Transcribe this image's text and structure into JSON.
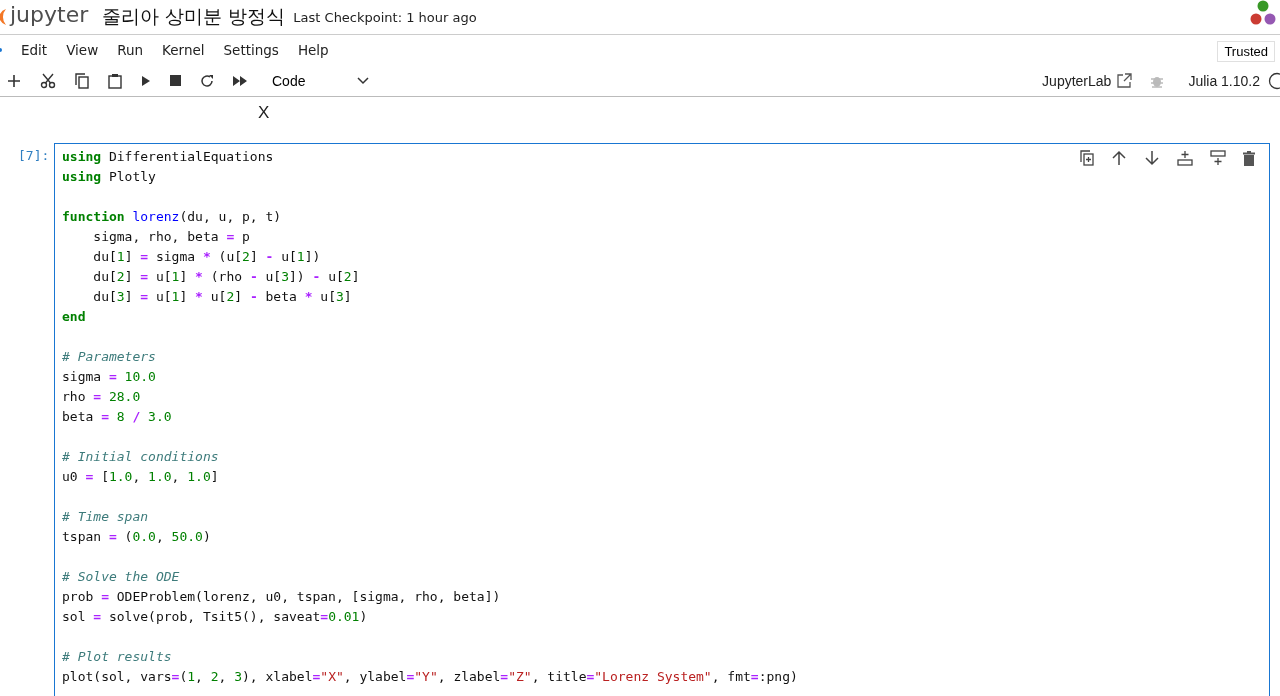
{
  "header": {
    "logo": "jupyter",
    "title": "줄리아 상미분 방정식",
    "checkpoint": "Last Checkpoint: 1 hour ago"
  },
  "menu": [
    "Edit",
    "View",
    "Run",
    "Kernel",
    "Settings",
    "Help"
  ],
  "trusted": "Trusted",
  "toolbar": {
    "cell_type": "Code",
    "jupyterlab": "JupyterLab",
    "kernel": "Julia 1.10.2"
  },
  "output_fragment": "X",
  "cell": {
    "prompt": "[7]:",
    "lines": [
      {
        "kind": "code",
        "tokens": [
          {
            "kind": "kw",
            "text": "using"
          },
          {
            "kind": "txt",
            "text": " DifferentialEquations"
          }
        ]
      },
      {
        "kind": "code",
        "tokens": [
          {
            "kind": "kw",
            "text": "using"
          },
          {
            "kind": "txt",
            "text": " Plotly"
          }
        ]
      },
      {
        "kind": "blank"
      },
      {
        "kind": "code",
        "tokens": [
          {
            "kind": "kw",
            "text": "function"
          },
          {
            "kind": "fn",
            "text": " lorenz"
          },
          {
            "kind": "txt",
            "text": "(du, u, p, t)"
          }
        ]
      },
      {
        "kind": "code",
        "tokens": [
          {
            "kind": "txt",
            "text": "    sigma, rho, beta "
          },
          {
            "kind": "op",
            "text": "="
          },
          {
            "kind": "txt",
            "text": " p"
          }
        ]
      },
      {
        "kind": "code",
        "tokens": [
          {
            "kind": "txt",
            "text": "    du["
          },
          {
            "kind": "num",
            "text": "1"
          },
          {
            "kind": "txt",
            "text": "] "
          },
          {
            "kind": "op",
            "text": "="
          },
          {
            "kind": "txt",
            "text": " sigma "
          },
          {
            "kind": "op",
            "text": "*"
          },
          {
            "kind": "txt",
            "text": " (u["
          },
          {
            "kind": "num",
            "text": "2"
          },
          {
            "kind": "txt",
            "text": "] "
          },
          {
            "kind": "op",
            "text": "-"
          },
          {
            "kind": "txt",
            "text": " u["
          },
          {
            "kind": "num",
            "text": "1"
          },
          {
            "kind": "txt",
            "text": "])"
          }
        ]
      },
      {
        "kind": "code",
        "tokens": [
          {
            "kind": "txt",
            "text": "    du["
          },
          {
            "kind": "num",
            "text": "2"
          },
          {
            "kind": "txt",
            "text": "] "
          },
          {
            "kind": "op",
            "text": "="
          },
          {
            "kind": "txt",
            "text": " u["
          },
          {
            "kind": "num",
            "text": "1"
          },
          {
            "kind": "txt",
            "text": "] "
          },
          {
            "kind": "op",
            "text": "*"
          },
          {
            "kind": "txt",
            "text": " (rho "
          },
          {
            "kind": "op",
            "text": "-"
          },
          {
            "kind": "txt",
            "text": " u["
          },
          {
            "kind": "num",
            "text": "3"
          },
          {
            "kind": "txt",
            "text": "]) "
          },
          {
            "kind": "op",
            "text": "-"
          },
          {
            "kind": "txt",
            "text": " u["
          },
          {
            "kind": "num",
            "text": "2"
          },
          {
            "kind": "txt",
            "text": "]"
          }
        ]
      },
      {
        "kind": "code",
        "tokens": [
          {
            "kind": "txt",
            "text": "    du["
          },
          {
            "kind": "num",
            "text": "3"
          },
          {
            "kind": "txt",
            "text": "] "
          },
          {
            "kind": "op",
            "text": "="
          },
          {
            "kind": "txt",
            "text": " u["
          },
          {
            "kind": "num",
            "text": "1"
          },
          {
            "kind": "txt",
            "text": "] "
          },
          {
            "kind": "op",
            "text": "*"
          },
          {
            "kind": "txt",
            "text": " u["
          },
          {
            "kind": "num",
            "text": "2"
          },
          {
            "kind": "txt",
            "text": "] "
          },
          {
            "kind": "op",
            "text": "-"
          },
          {
            "kind": "txt",
            "text": " beta "
          },
          {
            "kind": "op",
            "text": "*"
          },
          {
            "kind": "txt",
            "text": " u["
          },
          {
            "kind": "num",
            "text": "3"
          },
          {
            "kind": "txt",
            "text": "]"
          }
        ]
      },
      {
        "kind": "code",
        "tokens": [
          {
            "kind": "kw",
            "text": "end"
          }
        ]
      },
      {
        "kind": "blank"
      },
      {
        "kind": "code",
        "tokens": [
          {
            "kind": "cm",
            "text": "# Parameters"
          }
        ]
      },
      {
        "kind": "code",
        "tokens": [
          {
            "kind": "txt",
            "text": "sigma "
          },
          {
            "kind": "op",
            "text": "="
          },
          {
            "kind": "num",
            "text": " 10.0"
          }
        ]
      },
      {
        "kind": "code",
        "tokens": [
          {
            "kind": "txt",
            "text": "rho "
          },
          {
            "kind": "op",
            "text": "="
          },
          {
            "kind": "num",
            "text": " 28.0"
          }
        ]
      },
      {
        "kind": "code",
        "tokens": [
          {
            "kind": "txt",
            "text": "beta "
          },
          {
            "kind": "op",
            "text": "="
          },
          {
            "kind": "num",
            "text": " 8"
          },
          {
            "kind": "op",
            "text": " /"
          },
          {
            "kind": "num",
            "text": " 3.0"
          }
        ]
      },
      {
        "kind": "blank"
      },
      {
        "kind": "code",
        "tokens": [
          {
            "kind": "cm",
            "text": "# Initial conditions"
          }
        ]
      },
      {
        "kind": "code",
        "tokens": [
          {
            "kind": "txt",
            "text": "u0 "
          },
          {
            "kind": "op",
            "text": "="
          },
          {
            "kind": "txt",
            "text": " ["
          },
          {
            "kind": "num",
            "text": "1.0"
          },
          {
            "kind": "txt",
            "text": ", "
          },
          {
            "kind": "num",
            "text": "1.0"
          },
          {
            "kind": "txt",
            "text": ", "
          },
          {
            "kind": "num",
            "text": "1.0"
          },
          {
            "kind": "txt",
            "text": "]"
          }
        ]
      },
      {
        "kind": "blank"
      },
      {
        "kind": "code",
        "tokens": [
          {
            "kind": "cm",
            "text": "# Time span"
          }
        ]
      },
      {
        "kind": "code",
        "tokens": [
          {
            "kind": "txt",
            "text": "tspan "
          },
          {
            "kind": "op",
            "text": "="
          },
          {
            "kind": "txt",
            "text": " ("
          },
          {
            "kind": "num",
            "text": "0.0"
          },
          {
            "kind": "txt",
            "text": ", "
          },
          {
            "kind": "num",
            "text": "50.0"
          },
          {
            "kind": "txt",
            "text": ")"
          }
        ]
      },
      {
        "kind": "blank"
      },
      {
        "kind": "code",
        "tokens": [
          {
            "kind": "cm",
            "text": "# Solve the ODE"
          }
        ]
      },
      {
        "kind": "code",
        "tokens": [
          {
            "kind": "txt",
            "text": "prob "
          },
          {
            "kind": "op",
            "text": "="
          },
          {
            "kind": "txt",
            "text": " ODEProblem(lorenz, u0, tspan, [sigma, rho, beta])"
          }
        ]
      },
      {
        "kind": "code",
        "tokens": [
          {
            "kind": "txt",
            "text": "sol "
          },
          {
            "kind": "op",
            "text": "="
          },
          {
            "kind": "txt",
            "text": " solve(prob, Tsit5(), saveat"
          },
          {
            "kind": "op",
            "text": "="
          },
          {
            "kind": "num",
            "text": "0.01"
          },
          {
            "kind": "txt",
            "text": ")"
          }
        ]
      },
      {
        "kind": "blank"
      },
      {
        "kind": "code",
        "tokens": [
          {
            "kind": "cm",
            "text": "# Plot results"
          }
        ]
      },
      {
        "kind": "code",
        "tokens": [
          {
            "kind": "txt",
            "text": "plot(sol, vars"
          },
          {
            "kind": "op",
            "text": "="
          },
          {
            "kind": "txt",
            "text": "("
          },
          {
            "kind": "num",
            "text": "1"
          },
          {
            "kind": "txt",
            "text": ", "
          },
          {
            "kind": "num",
            "text": "2"
          },
          {
            "kind": "txt",
            "text": ", "
          },
          {
            "kind": "num",
            "text": "3"
          },
          {
            "kind": "txt",
            "text": "), xlabel"
          },
          {
            "kind": "op",
            "text": "="
          },
          {
            "kind": "str",
            "text": "\"X\""
          },
          {
            "kind": "txt",
            "text": ", ylabel"
          },
          {
            "kind": "op",
            "text": "="
          },
          {
            "kind": "str",
            "text": "\"Y\""
          },
          {
            "kind": "txt",
            "text": ", zlabel"
          },
          {
            "kind": "op",
            "text": "="
          },
          {
            "kind": "str",
            "text": "\"Z\""
          },
          {
            "kind": "txt",
            "text": ", title"
          },
          {
            "kind": "op",
            "text": "="
          },
          {
            "kind": "str",
            "text": "\"Lorenz System\""
          },
          {
            "kind": "txt",
            "text": ", fmt"
          },
          {
            "kind": "op",
            "text": "="
          },
          {
            "kind": "txt",
            "text": ":png)"
          }
        ]
      }
    ]
  }
}
